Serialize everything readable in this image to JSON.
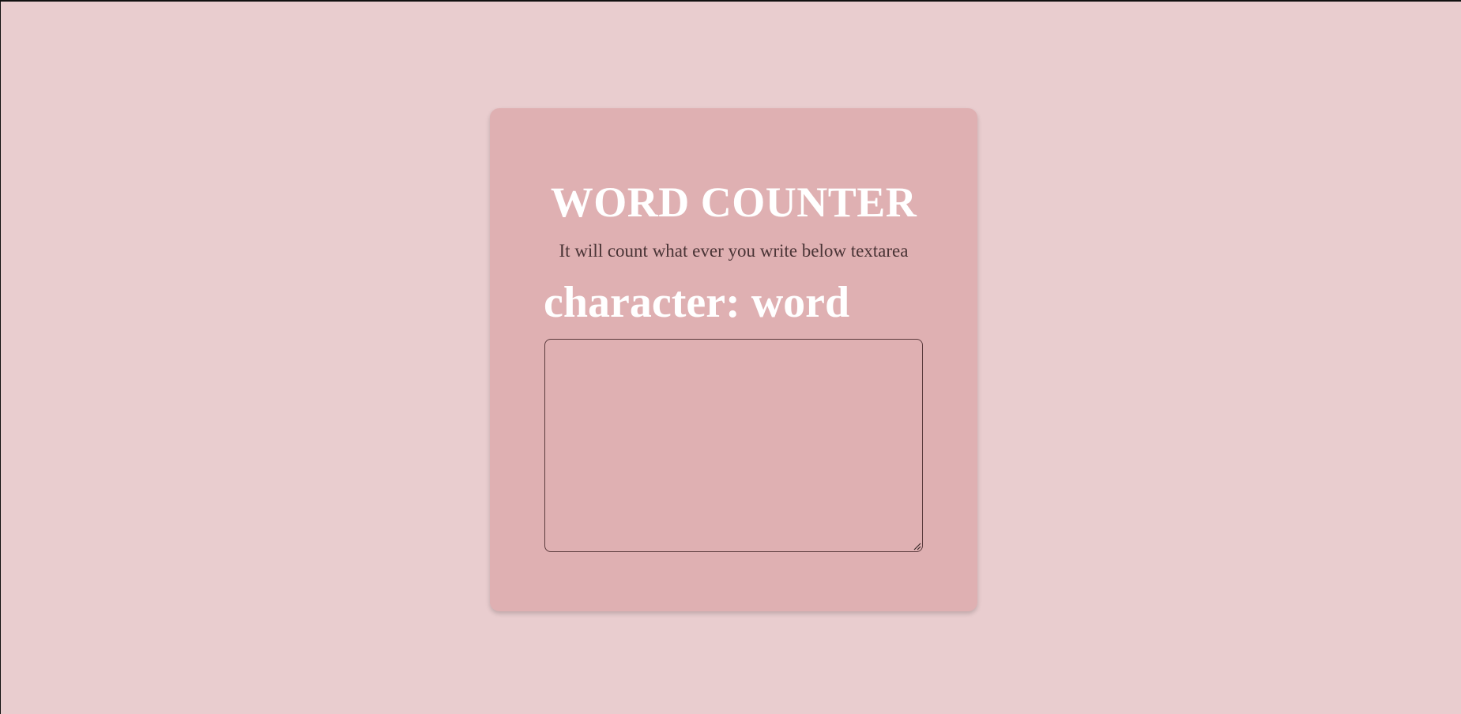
{
  "app": {
    "title": "WORD COUNTER",
    "subtitle": "It will count what ever you write below textarea"
  },
  "counter": {
    "character_label": "character:",
    "word_label": "word"
  },
  "input": {
    "value": "",
    "placeholder": ""
  },
  "colors": {
    "page_background": "#e9cdcf",
    "card_background": "#dfb0b2",
    "title_text": "#ffffff",
    "subtitle_text": "#4a3436",
    "textarea_border": "#5a3a3c"
  },
  "icons": {
    "resize_handle": "resize-grip-icon"
  }
}
